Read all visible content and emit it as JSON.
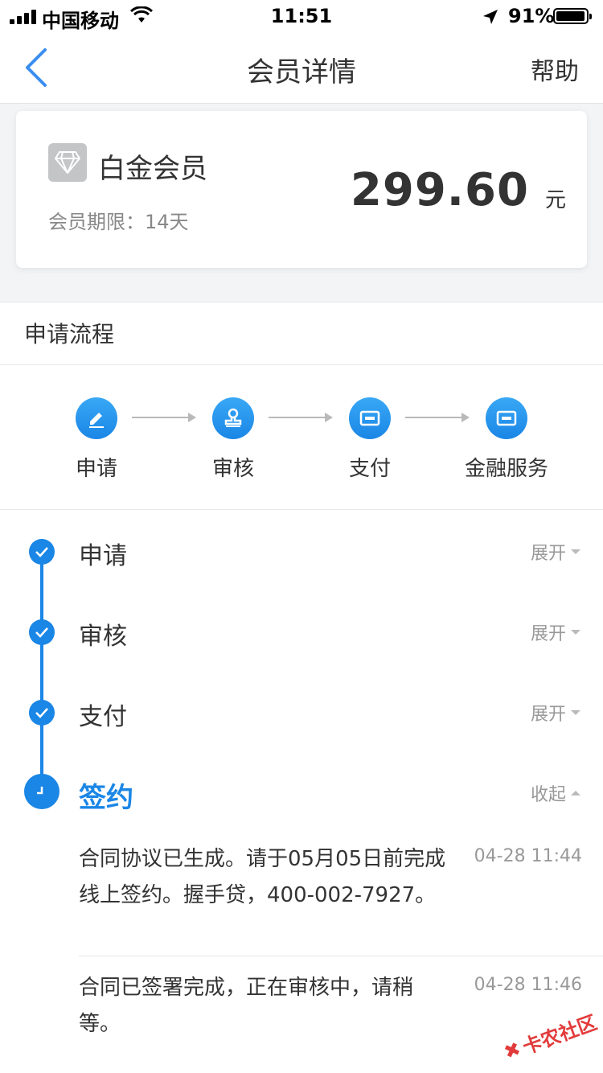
{
  "status_bar": {
    "carrier": "中国移动",
    "time": "11:51",
    "battery": "91%"
  },
  "nav": {
    "title": "会员详情",
    "help": "帮助"
  },
  "member_card": {
    "level": "白金会员",
    "period": "会员期限：14天",
    "price": "299.60",
    "unit": "元"
  },
  "process": {
    "title": "申请流程",
    "steps": [
      {
        "label": "申请",
        "icon": "pen-icon"
      },
      {
        "label": "审核",
        "icon": "stamp-icon"
      },
      {
        "label": "支付",
        "icon": "card-icon"
      },
      {
        "label": "金融服务",
        "icon": "card-icon"
      }
    ]
  },
  "timeline": {
    "items": [
      {
        "title": "申请",
        "toggle": "展开",
        "state": "done"
      },
      {
        "title": "审核",
        "toggle": "展开",
        "state": "done"
      },
      {
        "title": "支付",
        "toggle": "展开",
        "state": "done"
      },
      {
        "title": "签约",
        "toggle": "收起",
        "state": "current"
      }
    ],
    "messages": [
      {
        "text": "合同协议已生成。请于05月05日前完成线上签约。握手贷，400-002-7927。",
        "time": "04-28 11:44"
      },
      {
        "text": "合同已签署完成，正在审核中，请稍等。",
        "time": "04-28 11:46"
      }
    ]
  },
  "watermark": "卡农社区",
  "colors": {
    "accent": "#1a86e6",
    "muted": "#999999"
  }
}
